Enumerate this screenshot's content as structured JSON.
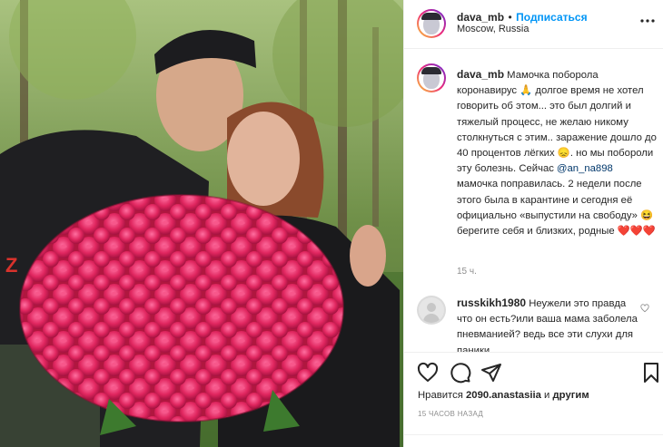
{
  "header": {
    "username": "dava_mb",
    "separator": "•",
    "follow_label": "Подписаться",
    "location": "Moscow, Russia"
  },
  "caption": {
    "username": "dava_mb",
    "text_1": "Мамочка поборола коронавирус 🙏 долгое время не хотел говорить об этом... это был долгий и тяжелый процесс, не желаю никому столкнуться с этим.. заражение дошло до 40 процентов лёгких 😞. но мы побороли эту болезнь. Сейчас ",
    "mention": "@an_na898",
    "text_2": " мамочка поправилась. 2 недели после этого была в карантине и сегодня её официально «выпустили на свободу» 😆 берегите себя и близких, родные ❤️❤️❤️",
    "time": "15 ч."
  },
  "comment": {
    "username": "russkikh1980",
    "text": "Неужели это правда что он есть?или ваша мама заболела пневманией? ведь все эти слухи для паники"
  },
  "actions": {
    "likes_prefix": "Нравится ",
    "likes_user": "2090.anastasiia",
    "likes_suffix": " и ",
    "likes_others": "другим",
    "timestamp": "15 ЧАСОВ НАЗАД"
  },
  "colors": {
    "accent": "#0095f6",
    "mention": "#00376b",
    "muted": "#8e8e8e",
    "rose": "#e0265f"
  },
  "icons": [
    "more-options-icon",
    "heart-icon",
    "comment-icon",
    "share-icon",
    "bookmark-icon"
  ]
}
